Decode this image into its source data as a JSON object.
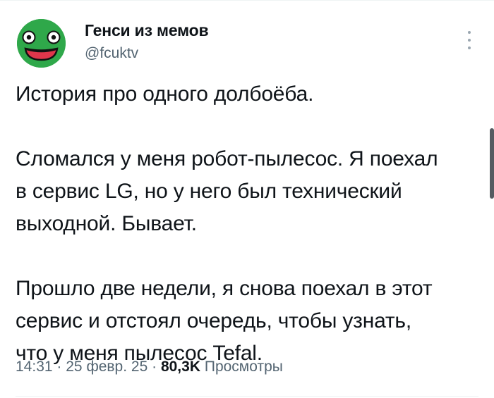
{
  "author": {
    "display_name": "Генси из мемов",
    "handle": "@fcuktv",
    "avatar_icon": "frog-face-avatar",
    "avatar_color": "#2fa84a"
  },
  "tweet": {
    "paragraphs": [
      "История про одного долбоёба.",
      "Сломался у меня робот-пылесос. Я поехал\nв сервис LG, но у него был технический\nвыходной. Бывает.",
      "Прошло две недели, я снова поехал в этот\nсервис и отстоял очередь, чтобы узнать,\nчто у меня пылесос Tefal."
    ]
  },
  "meta": {
    "time": "14:31",
    "separator": "·",
    "date": "25 февр. 25",
    "views_count": "80,3K",
    "views_label": "Просмотры"
  },
  "icons": {
    "more": "more-vertical-icon"
  }
}
